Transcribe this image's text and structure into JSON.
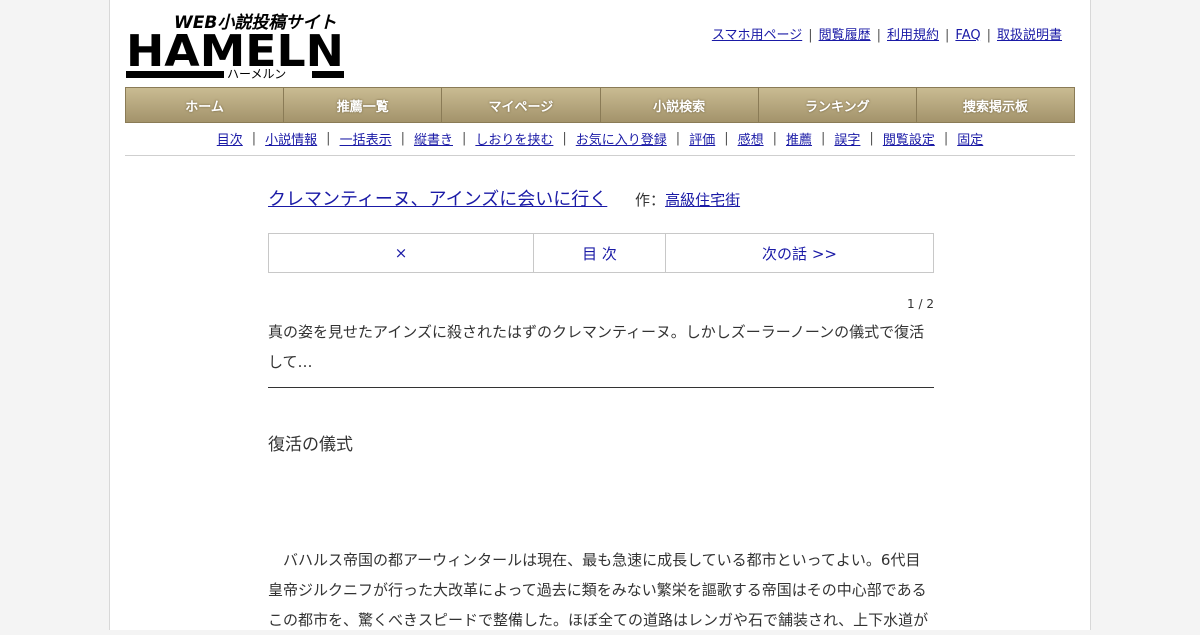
{
  "logo": {
    "tagline": "WEB小説投稿サイト",
    "name": "HAMELN",
    "kana": "ハーメルン"
  },
  "header": {
    "links": [
      "スマホ用ページ",
      "閲覧履歴",
      "利用規約",
      "FAQ",
      "取扱説明書"
    ]
  },
  "main_nav": {
    "tabs": [
      "ホーム",
      "推薦一覧",
      "マイページ",
      "小説検索",
      "ランキング",
      "捜索掲示板"
    ]
  },
  "sub_nav": {
    "items": [
      "目次",
      "小説情報",
      "一括表示",
      "縦書き",
      "しおりを挟む",
      "お気に入り登録",
      "評価",
      "感想",
      "推薦",
      "誤字",
      "閲覧設定",
      "固定"
    ]
  },
  "novel": {
    "title": "クレマンティーヌ、アインズに会いに行く",
    "author_prefix": "作：",
    "author": "高級住宅街"
  },
  "chapter_nav": {
    "close": "×",
    "toc": "目 次",
    "next": "次の話 >>"
  },
  "page_indicator": "1 / 2",
  "summary": "真の姿を見せたアインズに殺されたはずのクレマンティーヌ。しかしズーラーノーンの儀式で復活して…",
  "chapter_title": "復活の儀式",
  "body": "　バハルス帝国の都アーウィンタールは現在、最も急速に成長している都市といってよい。6代目皇帝ジルクニフが行った大改革によって過去に類をみない繁栄を謳歌する帝国はその中心部であるこの都市を、驚くべきスピードで整備した。ほぼ全ての道路はレンガや石で舗装され、上下水道が"
}
